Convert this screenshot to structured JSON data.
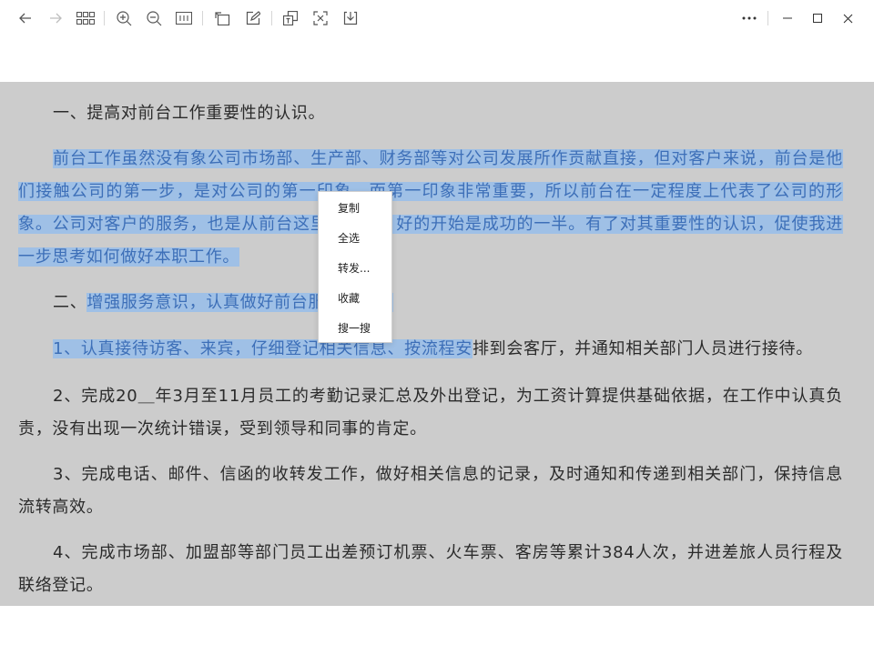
{
  "toolbar": {
    "left_icons": [
      "back-arrow-icon",
      "forward-arrow-icon",
      "grid-icon",
      "zoom-in-icon",
      "zoom-out-icon",
      "fit-width-icon",
      "rotate-icon",
      "edit-icon",
      "copy-text-icon",
      "scan-icon",
      "download-icon"
    ],
    "right_icons": [
      "more-icon",
      "minimize-icon",
      "maximize-icon",
      "close-icon"
    ]
  },
  "document": {
    "paragraphs": [
      {
        "parts": [
          {
            "text": "一、提高对前台工作重要性的认识。",
            "selected": false
          }
        ]
      },
      {
        "parts": [
          {
            "text": "前台工作虽然没有象公司市场部、生产部、财务部等对公司发展所作贡献直接，但对客户来说，前台是他们接触公司的第一步，是对公司的第一印象，而第一印象非常重要，所以前台在一定程度上代表了公司的形象。公司对客户的服务，也是从前台这里开始的，好的开始是成功的一半。有了对其重要性的认识，促使我进一步思考如何做好本职工作。",
            "selected": true
          }
        ]
      },
      {
        "parts": [
          {
            "text": "二、",
            "selected": false
          },
          {
            "text": "增强服务意识，认真做好前台服务工作。",
            "selected": true
          }
        ]
      },
      {
        "parts": [
          {
            "text": "1、认真接待访客、来宾，仔细登记相关信息、按流程安",
            "selected": true
          },
          {
            "text": "排到会客厅，并通知相关部门人员进行接待。",
            "selected": false
          }
        ]
      },
      {
        "parts": [
          {
            "text": "2、完成20＿年3月至11月员工的考勤记录汇总及外出登记，为工资计算提供基础依据，在工作中认真负责，没有出现一次统计错误，受到领导和同事的肯定。",
            "selected": false
          }
        ]
      },
      {
        "parts": [
          {
            "text": "3、完成电话、邮件、信函的收转发工作，做好相关信息的记录，及时通知和传递到相关部门，保持信息流转高效。",
            "selected": false
          }
        ]
      },
      {
        "parts": [
          {
            "text": "4、完成市场部、加盟部等部门员工出差预订机票、火车票、客房等累计384人次，并进差旅人员行程及联络登记。",
            "selected": false
          }
        ]
      }
    ]
  },
  "context_menu": {
    "items": [
      "复制",
      "全选",
      "转发...",
      "收藏",
      "搜一搜"
    ]
  },
  "colors": {
    "page_background": "#cccccc",
    "selection": "#9fc0e6",
    "selected_text": "#3d6fb8",
    "text": "#2b2b2b"
  }
}
